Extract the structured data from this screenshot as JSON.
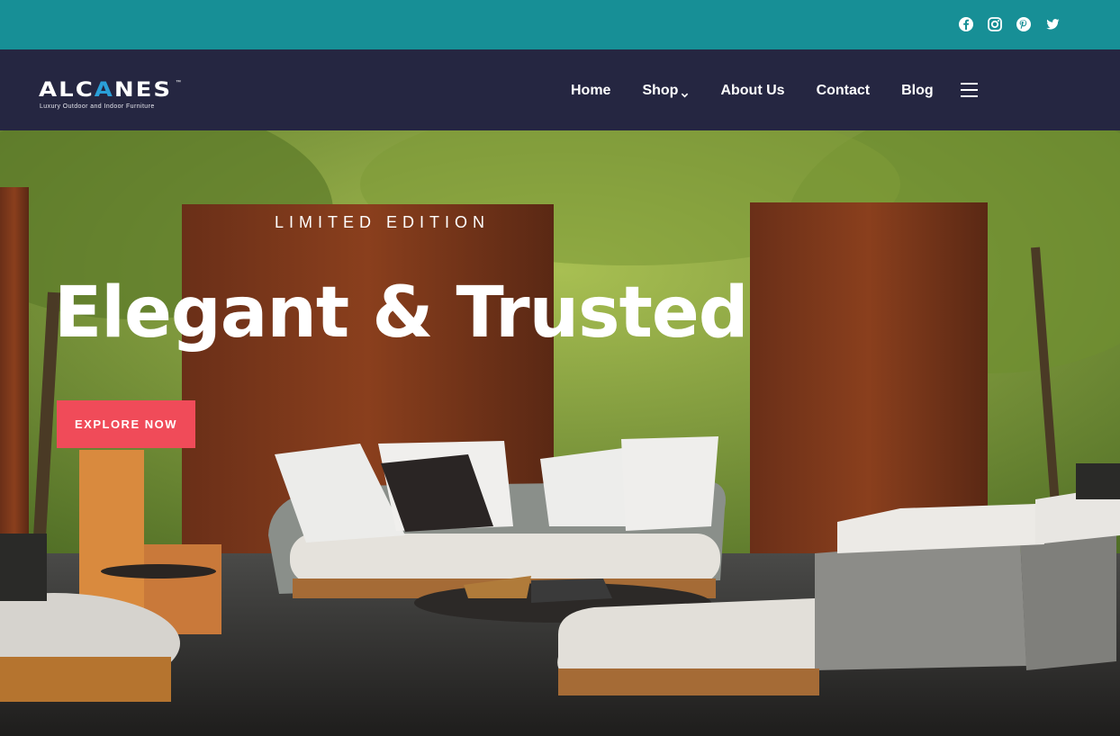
{
  "colors": {
    "topbar_bg": "#178f96",
    "header_bg": "#252641",
    "cta_bg": "#f04b59",
    "logo_accent": "#2a9fd8"
  },
  "social": [
    {
      "name": "facebook-icon"
    },
    {
      "name": "instagram-icon"
    },
    {
      "name": "pinterest-icon"
    },
    {
      "name": "twitter-icon"
    }
  ],
  "logo": {
    "word_start": "ALC",
    "word_accent": "A",
    "word_end": "NES",
    "trademark": "™",
    "tagline": "Luxury Outdoor and Indoor Furniture"
  },
  "nav": {
    "home": "Home",
    "shop": "Shop",
    "about": "About Us",
    "contact": "Contact",
    "blog": "Blog"
  },
  "hero": {
    "eyebrow": "LIMITED EDITION",
    "headline": "Elegant & Trusted",
    "cta_label": "EXPLORE NOW"
  }
}
